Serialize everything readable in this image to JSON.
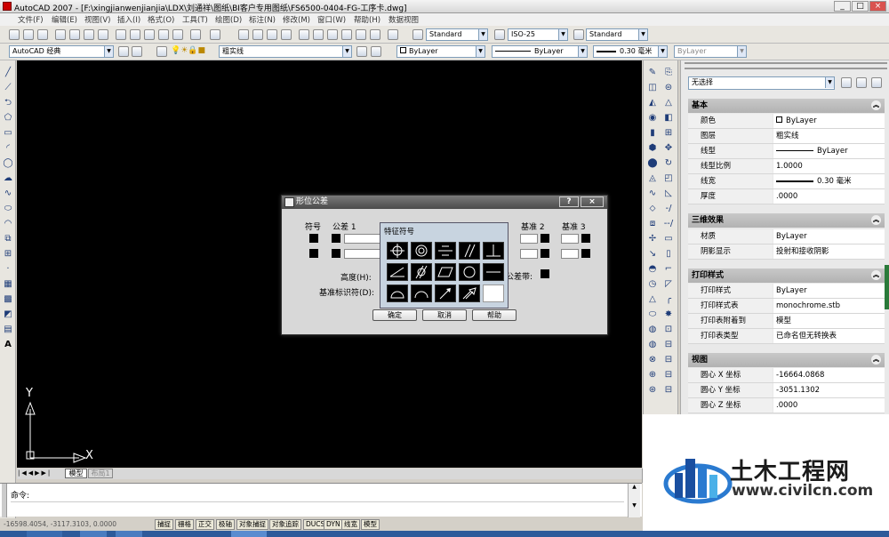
{
  "window": {
    "title": "AutoCAD 2007 - [F:\\xingjianwenjianjia\\LDX\\刘通祥\\图纸\\BI客户专用图纸\\FS6500-0404-FG-工序卡.dwg]",
    "min": "_",
    "max": "□",
    "close": "×"
  },
  "menu": [
    "文件(F)",
    "编辑(E)",
    "视图(V)",
    "插入(I)",
    "格式(O)",
    "工具(T)",
    "绘图(D)",
    "标注(N)",
    "修改(M)",
    "窗口(W)",
    "帮助(H)",
    "数据视图"
  ],
  "toolbar": {
    "text_style": "Standard",
    "dim_style": "ISO-25",
    "table_style": "Standard",
    "workspace": "AutoCAD 经典",
    "layer": "粗实线",
    "color": "ByLayer",
    "linetype": "ByLayer",
    "lineweight": "0.30 毫米",
    "plotstyle": "ByLayer"
  },
  "properties": {
    "selector": "无选择",
    "sections": [
      {
        "title": "基本",
        "rows": [
          [
            "颜色",
            "ByLayer"
          ],
          [
            "图层",
            "粗实线"
          ],
          [
            "线型",
            "ByLayer"
          ],
          [
            "线型比例",
            "1.0000"
          ],
          [
            "线宽",
            "0.30 毫米"
          ],
          [
            "厚度",
            ".0000"
          ]
        ]
      },
      {
        "title": "三维效果",
        "rows": [
          [
            "材质",
            "ByLayer"
          ],
          [
            "阴影显示",
            "投射和接收阴影"
          ]
        ]
      },
      {
        "title": "打印样式",
        "rows": [
          [
            "打印样式",
            "ByLayer"
          ],
          [
            "打印样式表",
            "monochrome.stb"
          ],
          [
            "打印表附着到",
            "模型"
          ],
          [
            "打印表类型",
            "已命名但无转换表"
          ]
        ]
      },
      {
        "title": "视图",
        "rows": [
          [
            "圆心 X 坐标",
            "-16664.0868"
          ],
          [
            "圆心 Y 坐标",
            "-3051.1302"
          ],
          [
            "圆心 Z 坐标",
            ".0000"
          ]
        ]
      }
    ]
  },
  "ucs": {
    "x": "X",
    "y": "Y"
  },
  "layout_tabs": [
    "模型",
    "布局1"
  ],
  "command": {
    "prompt": "命令:"
  },
  "status": {
    "coords": "-16598.4054, -3117.3103, 0.0000",
    "toggles": [
      "捕捉",
      "栅格",
      "正交",
      "极轴",
      "对象捕捉",
      "对象追踪",
      "DUCS",
      "DYN",
      "线宽",
      "模型"
    ]
  },
  "dialog": {
    "title": "形位公差",
    "help": "?",
    "close": "×",
    "col_symbol": "符号",
    "col_tol1": "公差 1",
    "col_datum2": "基准 2",
    "col_datum3": "基准 3",
    "height_label": "高度(H):",
    "datum_id_label": "基准标识符(D):",
    "tol_zone_label": "公差带:",
    "ok": "确定",
    "cancel": "取消",
    "help_btn": "帮助"
  },
  "symbol_picker": {
    "title": "特征符号",
    "symbols": [
      "position-symbol",
      "concentricity-symbol",
      "symmetry-symbol",
      "parallelism-symbol",
      "perpendicularity-symbol",
      "angularity-symbol",
      "cylindricity-symbol",
      "flatness-symbol",
      "circularity-symbol",
      "straightness-symbol",
      "profile-surface-symbol",
      "profile-line-symbol",
      "circular-runout-symbol",
      "total-runout-symbol"
    ]
  },
  "watermark": {
    "brand": "土木工程网",
    "url": "www.civilcn.com"
  }
}
